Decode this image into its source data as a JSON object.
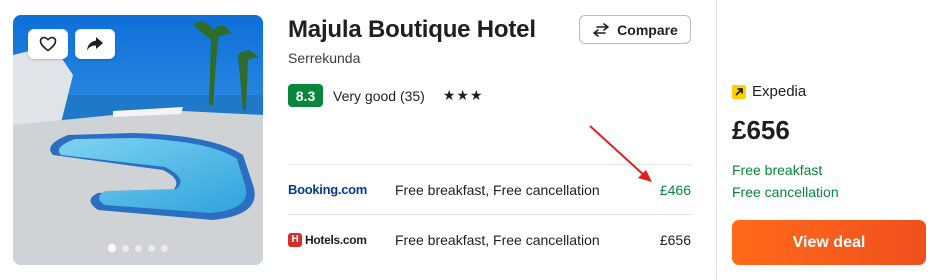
{
  "hotel": {
    "name": "Majula Boutique Hotel",
    "location": "Serrekunda",
    "score": "8.3",
    "rating_text": "Very good (35)",
    "stars": "★★★",
    "photo_count": 5,
    "active_photo": 1
  },
  "compare": {
    "label": "Compare"
  },
  "offers": [
    {
      "provider": "Booking.com",
      "description": "Free breakfast, Free cancellation",
      "price": "£466"
    },
    {
      "provider": "Hotels.com",
      "description": "Free breakfast, Free cancellation",
      "price": "£656"
    }
  ],
  "featured": {
    "provider": "Expedia",
    "price": "£656",
    "perks": [
      "Free breakfast",
      "Free cancellation"
    ],
    "cta": "View deal"
  },
  "colors": {
    "accent_green": "#07873d",
    "cta_orange": "#ff6a1a",
    "booking_blue": "#003a94",
    "annotation_red": "#e0201b"
  }
}
